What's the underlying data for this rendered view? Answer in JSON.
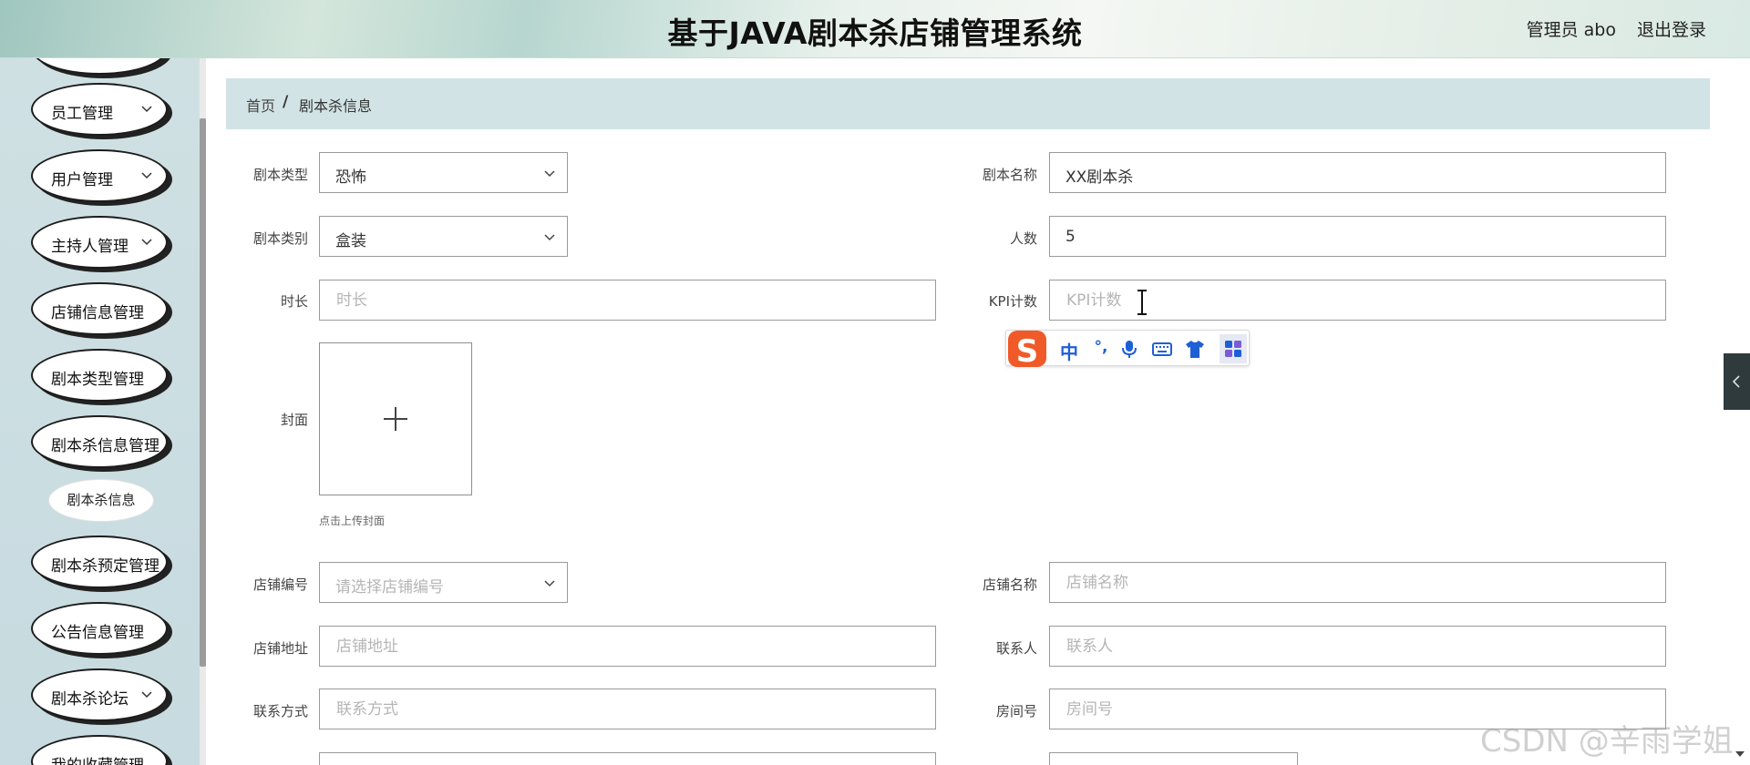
{
  "header": {
    "title": "基于JAVA剧本杀店铺管理系统",
    "user": "管理员 abo",
    "logout": "退出登录"
  },
  "sidebar": {
    "items": [
      {
        "label": "员工管理"
      },
      {
        "label": "用户管理"
      },
      {
        "label": "主持人管理"
      },
      {
        "label": "店铺信息管理"
      },
      {
        "label": "剧本类型管理"
      },
      {
        "label": "剧本杀信息管理"
      },
      {
        "label": "剧本杀预定管理"
      },
      {
        "label": "公告信息管理"
      },
      {
        "label": "剧本杀论坛"
      },
      {
        "label": "我的收藏管理"
      }
    ],
    "submenu": {
      "label": "剧本杀信息"
    }
  },
  "breadcrumb": {
    "home": "首页",
    "separator": "/",
    "current": "剧本杀信息"
  },
  "form": {
    "script_type": {
      "label": "剧本类型",
      "value": "恐怖"
    },
    "script_name": {
      "label": "剧本名称",
      "value": "XX剧本杀"
    },
    "script_category": {
      "label": "剧本类别",
      "value": "盒装"
    },
    "players": {
      "label": "人数",
      "value": "5"
    },
    "duration": {
      "label": "时长",
      "placeholder": "时长"
    },
    "kpi": {
      "label": "KPI计数",
      "placeholder": "KPI计数"
    },
    "cover": {
      "label": "封面",
      "hint": "点击上传封面"
    },
    "shop_no": {
      "label": "店铺编号",
      "placeholder": "请选择店铺编号"
    },
    "shop_name": {
      "label": "店铺名称",
      "placeholder": "店铺名称"
    },
    "shop_address": {
      "label": "店铺地址",
      "placeholder": "店铺地址"
    },
    "contact": {
      "label": "联系人",
      "placeholder": "联系人"
    },
    "contact_method": {
      "label": "联系方式",
      "placeholder": "联系方式"
    },
    "room_no": {
      "label": "房间号",
      "placeholder": "房间号"
    }
  },
  "ime": {
    "mode": "中",
    "punct": "°,"
  },
  "watermark": "CSDN @辛雨学姐",
  "colors": {
    "sidebar_bg": "#cfe0e3",
    "breadcrumb_bg": "#d2e3e6",
    "ime_blue": "#1f5fd6",
    "ime_orange": "#f05a28"
  }
}
